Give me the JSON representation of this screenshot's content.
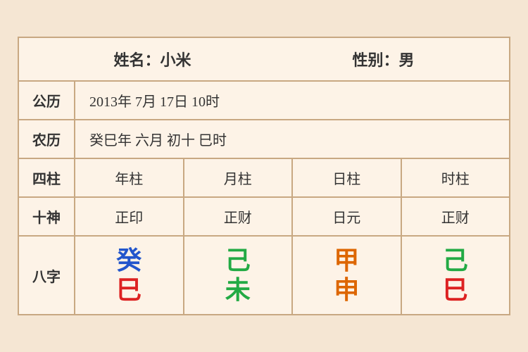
{
  "header": {
    "name_label": "姓名：小米",
    "gender_label": "性别：男"
  },
  "calendar": {
    "gregorian_label": "公历",
    "gregorian_value": "2013年 7月 17日 10时",
    "lunar_label": "农历",
    "lunar_value": "癸巳年 六月 初十 巳时"
  },
  "table": {
    "sijue_label": "四柱",
    "shishen_label": "十神",
    "bazi_label": "八字",
    "columns": [
      "年柱",
      "月柱",
      "日柱",
      "时柱"
    ],
    "shishen_values": [
      "正印",
      "正财",
      "日元",
      "正财"
    ],
    "bazi": [
      {
        "top": "癸",
        "bottom": "巳",
        "top_color": "blue",
        "bottom_color": "red"
      },
      {
        "top": "己",
        "bottom": "未",
        "top_color": "green",
        "bottom_color": "green"
      },
      {
        "top": "甲",
        "bottom": "申",
        "top_color": "orange",
        "bottom_color": "orange"
      },
      {
        "top": "己",
        "bottom": "巳",
        "top_color": "green",
        "bottom_color": "red"
      }
    ]
  }
}
